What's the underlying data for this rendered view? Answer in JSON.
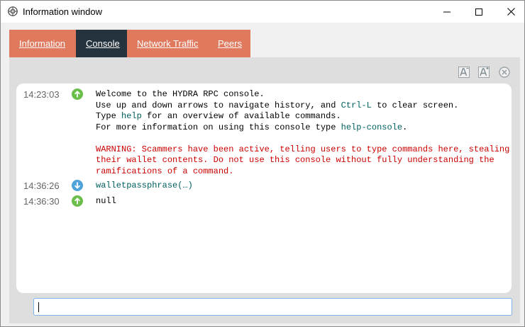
{
  "window": {
    "title": "Information window",
    "controls": {
      "minimize": "minimize-icon",
      "maximize": "maximize-icon",
      "close": "close-icon"
    }
  },
  "tabs": [
    {
      "label": "Information",
      "active": false
    },
    {
      "label": "Console",
      "active": true
    },
    {
      "label": "Network Traffic",
      "active": false
    },
    {
      "label": "Peers",
      "active": false
    }
  ],
  "toolbar": {
    "icons": [
      "font-smaller-icon",
      "font-larger-icon",
      "clear-console-icon"
    ]
  },
  "messages": [
    {
      "time": "14:23:03",
      "direction": "reply",
      "lines": {
        "l1": "Welcome to the HYDRA RPC console.",
        "l2_a": "Use up and down arrows to navigate history, and ",
        "l2_b": "Ctrl-L",
        "l2_c": " to clear screen.",
        "l3_a": "Type ",
        "l3_b": "help",
        "l3_c": " for an overview of available commands.",
        "l4_a": "For more information on using this console type ",
        "l4_b": "help-console",
        "l4_c": ".",
        "w1": "WARNING: Scammers have been active, telling users to type commands here, stealing",
        "w2": "their wallet contents. Do not use this console without fully understanding the",
        "w3": "ramifications of a command."
      }
    },
    {
      "time": "14:36:26",
      "direction": "request",
      "text": "walletpassphrase(…)"
    },
    {
      "time": "14:36:30",
      "direction": "reply",
      "text": "null"
    }
  ],
  "input": {
    "value": ""
  },
  "colors": {
    "tab_bg": "#e07a5f",
    "tab_active_bg": "#24333e",
    "reply_icon": "#6abf4b",
    "request_icon": "#4fa3d9",
    "warning_text": "#cc0000",
    "command_text": "#006060"
  }
}
